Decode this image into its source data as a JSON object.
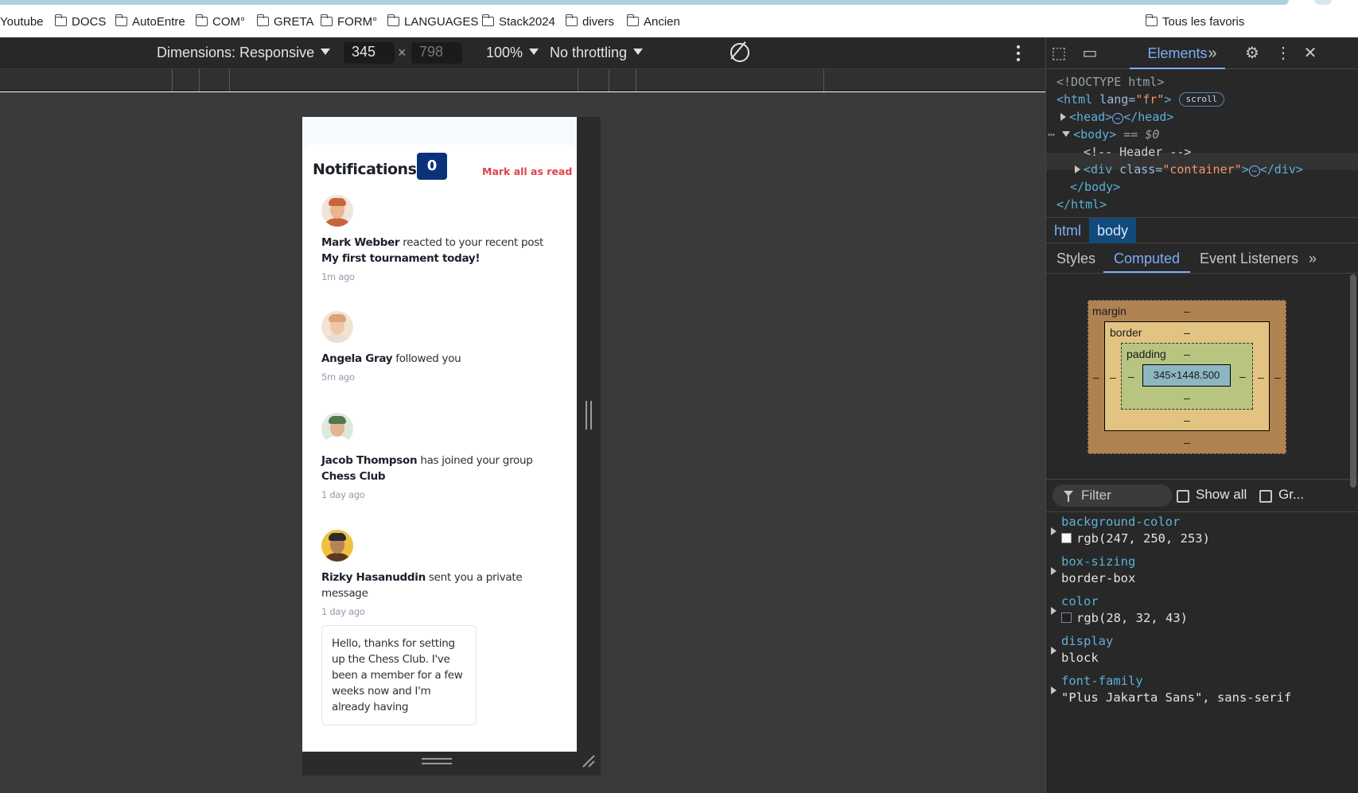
{
  "bookmarks": {
    "items": [
      {
        "label": "Youtube",
        "folder": false
      },
      {
        "label": "DOCS",
        "folder": true
      },
      {
        "label": "AutoEntre",
        "folder": true
      },
      {
        "label": "COM°",
        "folder": true
      },
      {
        "label": "GRETA",
        "folder": true
      },
      {
        "label": "FORM°",
        "folder": true
      },
      {
        "label": "LANGUAGES",
        "folder": true
      },
      {
        "label": "Stack2024",
        "folder": true
      },
      {
        "label": "divers",
        "folder": true
      },
      {
        "label": "Ancien",
        "folder": true
      }
    ],
    "all_bookmarks": "Tous les favoris"
  },
  "device_toolbar": {
    "dimensions_label": "Dimensions: Responsive",
    "width": "345",
    "times": "×",
    "height": "798",
    "zoom": "100%",
    "throttling": "No throttling"
  },
  "page": {
    "title": "Notifications",
    "unread_count": "0",
    "mark_all": "Mark all as read",
    "avatar_colors": [
      "#c8643c",
      "#d9a27a",
      "#4f7a4a",
      "#f0c040"
    ],
    "notifications": [
      {
        "name": "Mark Webber",
        "action": " reacted to your recent post",
        "target": "My first tournament today!",
        "time": "1m ago"
      },
      {
        "name": "Angela Gray",
        "action": " followed you",
        "target": "",
        "time": "5m ago"
      },
      {
        "name": "Jacob Thompson",
        "action": " has joined your group",
        "target": "Chess Club",
        "time": "1 day ago"
      },
      {
        "name": "Rizky Hasanuddin",
        "action": " sent you a private message",
        "target": "",
        "time": "1 day ago",
        "message": "Hello, thanks for setting up the Chess Club. I've been a member for a few weeks now and I'm already having"
      }
    ]
  },
  "devtools": {
    "tab_elements": "Elements",
    "dom": {
      "doctype": "<!DOCTYPE html>",
      "html_open": "<html",
      "html_attr": " lang=",
      "html_lang": "\"fr\"",
      "html_close_bracket": ">",
      "scroll_badge": "scroll",
      "head_open": "<head>",
      "head_close": "</head>",
      "body_open": "<body>",
      "body_eq": " == $0",
      "comment": "<!-- Header -->",
      "div_open": "<div",
      "div_attr": " class=",
      "div_class": "\"container\"",
      "div_close": "</div>",
      "body_close": "</body>",
      "html_close": "</html>",
      "ellipsis": "…"
    },
    "breadcrumbs": [
      "html",
      "body"
    ],
    "subtabs": [
      "Styles",
      "Computed",
      "Event Listeners"
    ],
    "box_model": {
      "margin": "margin",
      "border": "border",
      "padding": "padding",
      "content": "345×1448.500",
      "dash": "–"
    },
    "filter": {
      "placeholder": "Filter",
      "show_all": "Show all",
      "group": "Gr..."
    },
    "computed": [
      {
        "name": "background-color",
        "value": "rgb(247, 250, 253)",
        "swatch": "#f7fafd"
      },
      {
        "name": "box-sizing",
        "value": "border-box"
      },
      {
        "name": "color",
        "value": "rgb(28, 32, 43)",
        "swatch": "#1c202b"
      },
      {
        "name": "display",
        "value": "block"
      },
      {
        "name": "font-family",
        "value": "\"Plus Jakarta Sans\", sans-serif"
      }
    ]
  }
}
